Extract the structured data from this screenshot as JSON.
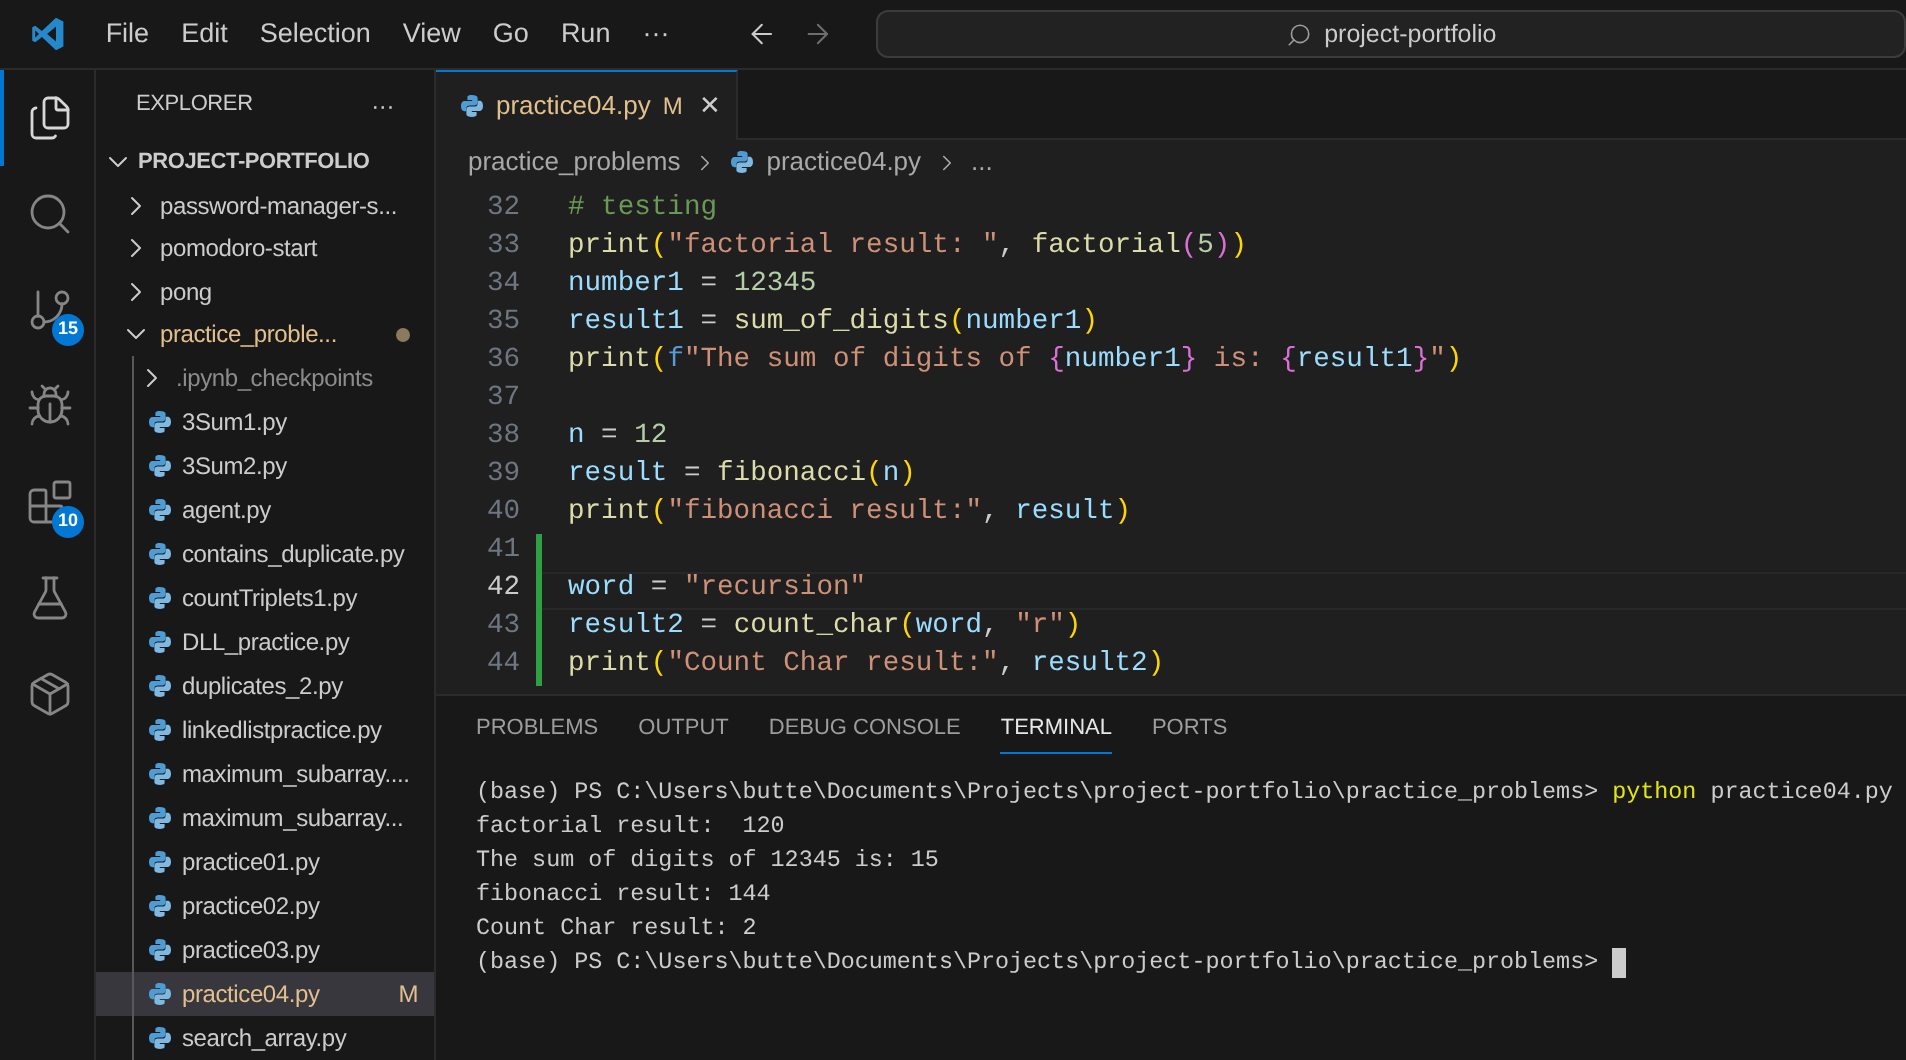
{
  "menu": [
    "File",
    "Edit",
    "Selection",
    "View",
    "Go",
    "Run",
    "···"
  ],
  "search": {
    "value": "project-portfolio"
  },
  "activity_bar": [
    {
      "kind": "explorer",
      "selected": true
    },
    {
      "kind": "search",
      "selected": false
    },
    {
      "kind": "source-control",
      "selected": false,
      "badge": "15"
    },
    {
      "kind": "run-debug",
      "selected": false
    },
    {
      "kind": "extensions",
      "selected": false,
      "badge": "10"
    },
    {
      "kind": "testing",
      "selected": false
    },
    {
      "kind": "extra",
      "selected": false
    }
  ],
  "sidebar": {
    "title": "EXPLORER",
    "more": "···",
    "tree": {
      "label": "PROJECT-PORTFOLIO",
      "expanded": true,
      "children": [
        {
          "label": "password-manager-s...",
          "kind": "folder",
          "expanded": false
        },
        {
          "label": "pomodoro-start",
          "kind": "folder",
          "expanded": false
        },
        {
          "label": "pong",
          "kind": "folder",
          "expanded": false
        },
        {
          "label": "practice_proble...",
          "kind": "folder",
          "expanded": true,
          "modified": true,
          "children": [
            {
              "label": ".ipynb_checkpoints",
              "kind": "folder",
              "expanded": false,
              "ignored": true
            },
            {
              "label": "3Sum1.py",
              "kind": "file",
              "selected": false
            },
            {
              "label": "3Sum2.py",
              "kind": "file",
              "selected": false
            },
            {
              "label": "agent.py",
              "kind": "file",
              "selected": false
            },
            {
              "label": "contains_duplicate.py",
              "kind": "file",
              "selected": false
            },
            {
              "label": "countTriplets1.py",
              "kind": "file",
              "selected": false
            },
            {
              "label": "DLL_practice.py",
              "kind": "file",
              "selected": false
            },
            {
              "label": "duplicates_2.py",
              "kind": "file",
              "selected": false
            },
            {
              "label": "linkedlistpractice.py",
              "kind": "file",
              "selected": false
            },
            {
              "label": "maximum_subarray....",
              "kind": "file",
              "selected": false
            },
            {
              "label": "maximum_subarray...",
              "kind": "file",
              "selected": false
            },
            {
              "label": "practice01.py",
              "kind": "file",
              "selected": false
            },
            {
              "label": "practice02.py",
              "kind": "file",
              "selected": false
            },
            {
              "label": "practice03.py",
              "kind": "file",
              "selected": false
            },
            {
              "label": "practice04.py",
              "kind": "file",
              "selected": true,
              "badge": "M"
            },
            {
              "label": "search_array.py",
              "kind": "file",
              "selected": false
            }
          ]
        }
      ]
    }
  },
  "editor_tabs": [
    {
      "label": "practice04.py",
      "badge": "M",
      "close": "✕",
      "selected": true
    }
  ],
  "breadcrumb": [
    "practice_problems",
    "practice04.py",
    "..."
  ],
  "code": [
    {
      "number": "32",
      "added": false,
      "current": false,
      "tokens": [
        {
          "kind": "comment",
          "text": "# testing"
        }
      ]
    },
    {
      "number": "33",
      "added": false,
      "current": false,
      "tokens": [
        {
          "kind": "func",
          "text": "print"
        },
        {
          "kind": "b1",
          "text": "("
        },
        {
          "kind": "str",
          "text": "\"factorial result: \""
        },
        {
          "kind": "op",
          "text": ", "
        },
        {
          "kind": "func",
          "text": "factorial"
        },
        {
          "kind": "b2",
          "text": "("
        },
        {
          "kind": "num",
          "text": "5"
        },
        {
          "kind": "b2",
          "text": ")"
        },
        {
          "kind": "b1",
          "text": ")"
        }
      ]
    },
    {
      "number": "34",
      "added": false,
      "current": false,
      "tokens": [
        {
          "kind": "var",
          "text": "number1"
        },
        {
          "kind": "op",
          "text": " = "
        },
        {
          "kind": "num",
          "text": "12345"
        }
      ]
    },
    {
      "number": "35",
      "added": false,
      "current": false,
      "tokens": [
        {
          "kind": "var",
          "text": "result1"
        },
        {
          "kind": "op",
          "text": " = "
        },
        {
          "kind": "func",
          "text": "sum_of_digits"
        },
        {
          "kind": "b1",
          "text": "("
        },
        {
          "kind": "var",
          "text": "number1"
        },
        {
          "kind": "b1",
          "text": ")"
        }
      ]
    },
    {
      "number": "36",
      "added": false,
      "current": false,
      "tokens": [
        {
          "kind": "func",
          "text": "print"
        },
        {
          "kind": "b1",
          "text": "("
        },
        {
          "kind": "kw",
          "text": "f"
        },
        {
          "kind": "str",
          "text": "\"The sum of digits of "
        },
        {
          "kind": "b2",
          "text": "{"
        },
        {
          "kind": "var",
          "text": "number1"
        },
        {
          "kind": "b2",
          "text": "}"
        },
        {
          "kind": "str",
          "text": " is: "
        },
        {
          "kind": "b2",
          "text": "{"
        },
        {
          "kind": "var",
          "text": "result1"
        },
        {
          "kind": "b2",
          "text": "}"
        },
        {
          "kind": "str",
          "text": "\""
        },
        {
          "kind": "b1",
          "text": ")"
        }
      ]
    },
    {
      "number": "37",
      "added": false,
      "current": false
    },
    {
      "number": "38",
      "added": false,
      "current": false,
      "tokens": [
        {
          "kind": "var",
          "text": "n"
        },
        {
          "kind": "op",
          "text": " = "
        },
        {
          "kind": "num",
          "text": "12"
        }
      ]
    },
    {
      "number": "39",
      "added": false,
      "current": false,
      "tokens": [
        {
          "kind": "var",
          "text": "result"
        },
        {
          "kind": "op",
          "text": " = "
        },
        {
          "kind": "func",
          "text": "fibonacci"
        },
        {
          "kind": "b1",
          "text": "("
        },
        {
          "kind": "var",
          "text": "n"
        },
        {
          "kind": "b1",
          "text": ")"
        }
      ]
    },
    {
      "number": "40",
      "added": false,
      "current": false,
      "tokens": [
        {
          "kind": "func",
          "text": "print"
        },
        {
          "kind": "b1",
          "text": "("
        },
        {
          "kind": "str",
          "text": "\"fibonacci result:\""
        },
        {
          "kind": "op",
          "text": ", "
        },
        {
          "kind": "var",
          "text": "result"
        },
        {
          "kind": "b1",
          "text": ")"
        }
      ]
    },
    {
      "number": "41",
      "added": true,
      "current": false
    },
    {
      "number": "42",
      "added": true,
      "current": true,
      "tokens": [
        {
          "kind": "var",
          "text": "word"
        },
        {
          "kind": "op",
          "text": " = "
        },
        {
          "kind": "str",
          "text": "\"recursion\""
        }
      ]
    },
    {
      "number": "43",
      "added": true,
      "current": false,
      "tokens": [
        {
          "kind": "var",
          "text": "result2"
        },
        {
          "kind": "op",
          "text": " = "
        },
        {
          "kind": "func",
          "text": "count_char"
        },
        {
          "kind": "b1",
          "text": "("
        },
        {
          "kind": "var",
          "text": "word"
        },
        {
          "kind": "op",
          "text": ", "
        },
        {
          "kind": "str",
          "text": "\"r\""
        },
        {
          "kind": "b1",
          "text": ")"
        }
      ]
    },
    {
      "number": "44",
      "added": true,
      "current": false,
      "tokens": [
        {
          "kind": "func",
          "text": "print"
        },
        {
          "kind": "b1",
          "text": "("
        },
        {
          "kind": "str",
          "text": "\"Count Char result:\""
        },
        {
          "kind": "op",
          "text": ", "
        },
        {
          "kind": "var",
          "text": "result2"
        },
        {
          "kind": "b1",
          "text": ")"
        }
      ]
    }
  ],
  "panel_tabs": [
    {
      "label": "PROBLEMS",
      "selected": false
    },
    {
      "label": "OUTPUT",
      "selected": false
    },
    {
      "label": "DEBUG CONSOLE",
      "selected": false
    },
    {
      "label": "TERMINAL",
      "selected": true
    },
    {
      "label": "PORTS",
      "selected": false
    }
  ],
  "terminal": [
    {
      "kind": "prompt",
      "text": "(base) PS C:\\Users\\butte\\Documents\\Projects\\project-portfolio\\practice_problems> ",
      "command": "python",
      "args": " practice04.py"
    },
    {
      "kind": "output",
      "text": "factorial result:  120"
    },
    {
      "kind": "output",
      "text": "The sum of digits of 12345 is: 15"
    },
    {
      "kind": "output",
      "text": "fibonacci result: 144"
    },
    {
      "kind": "output",
      "text": "Count Char result: 2"
    },
    {
      "kind": "prompt",
      "text": "(base) PS C:\\Users\\butte\\Documents\\Projects\\project-portfolio\\practice_problems> ",
      "cursor": true
    }
  ]
}
